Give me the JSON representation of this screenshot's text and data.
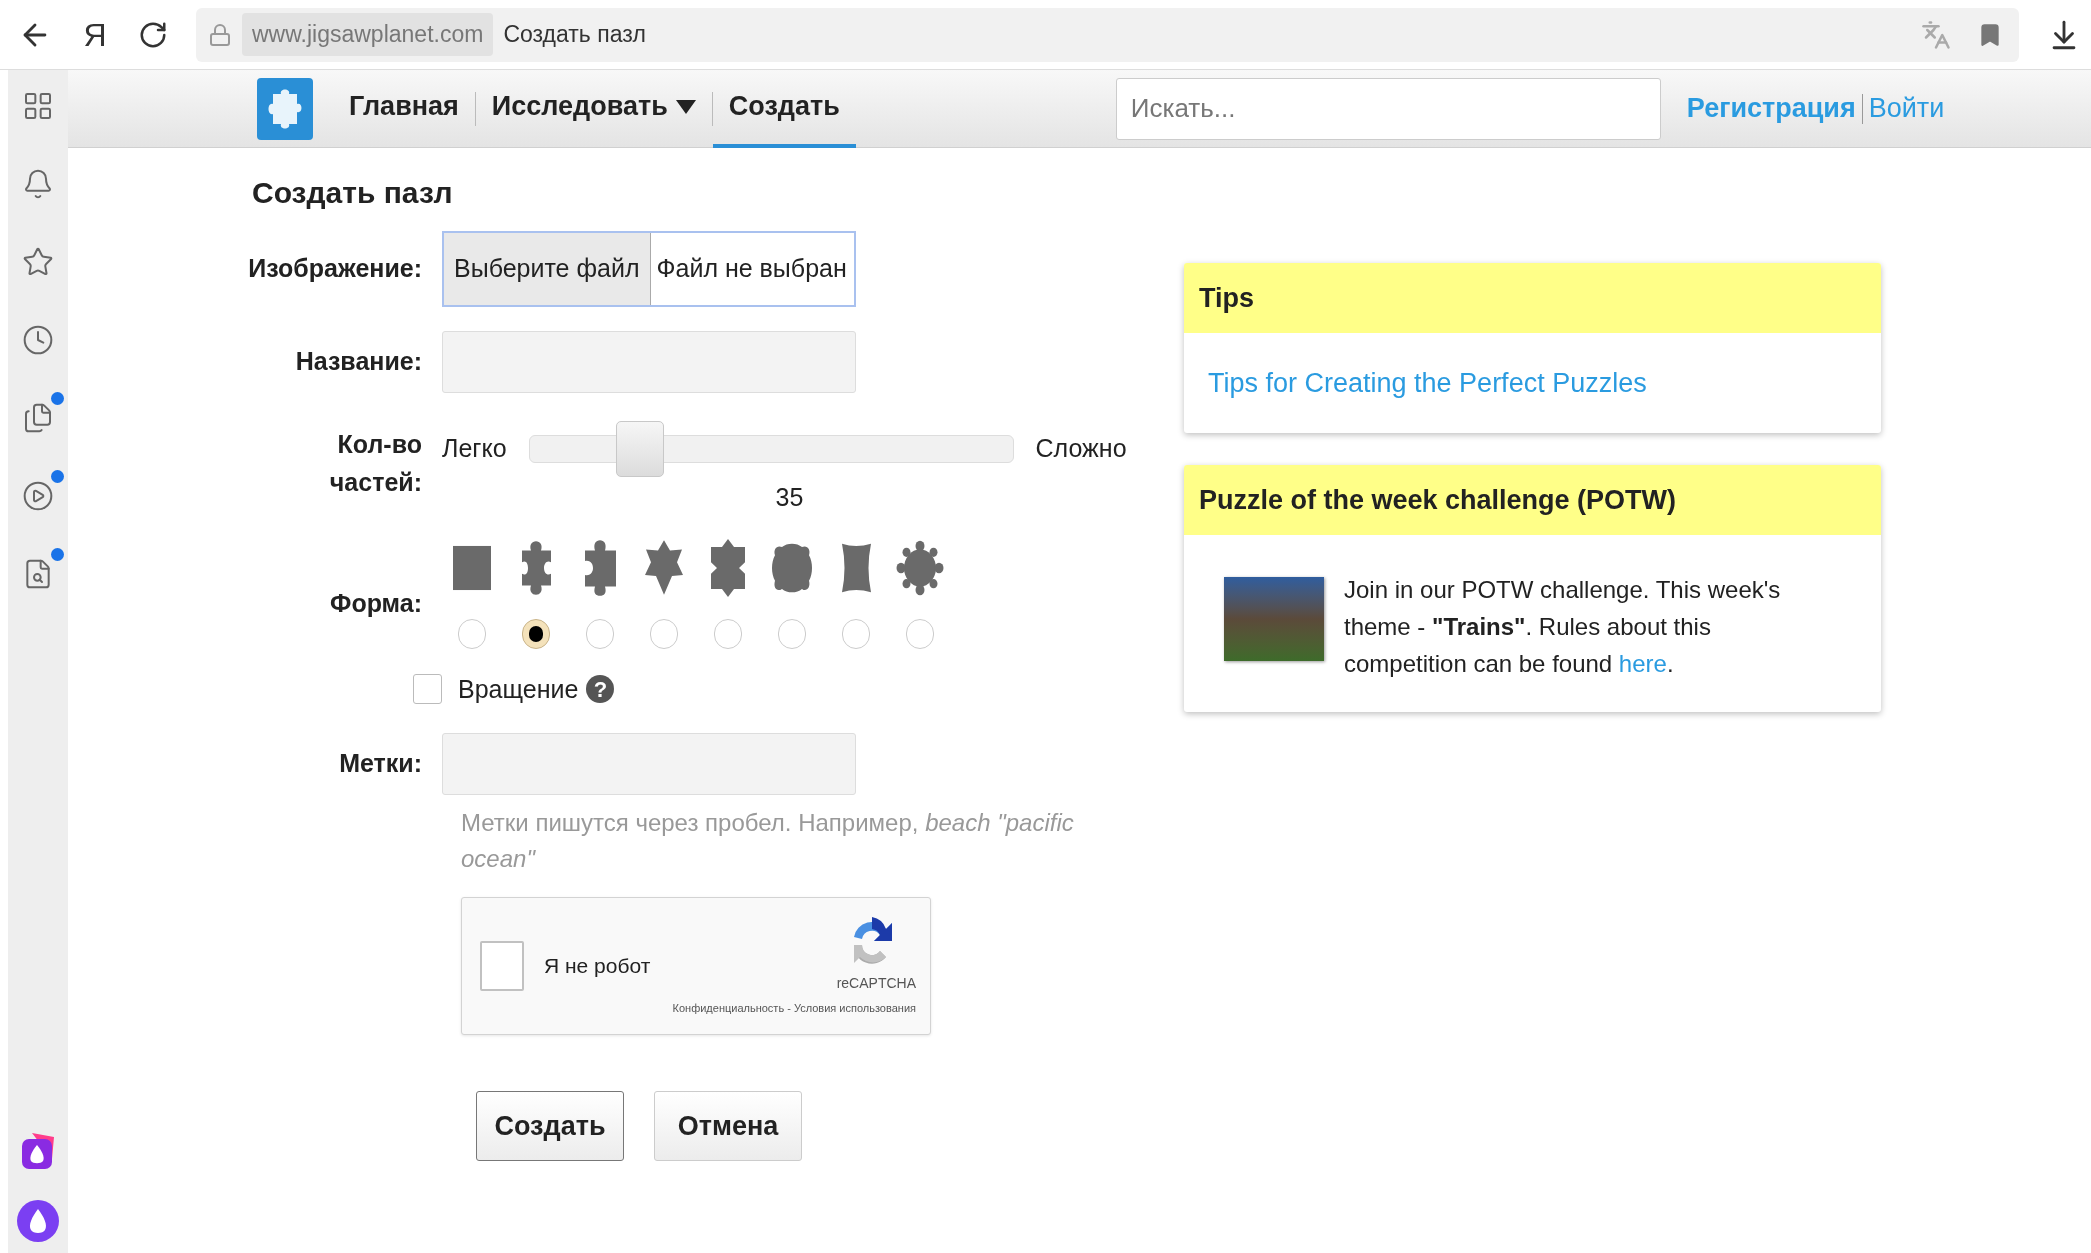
{
  "browser": {
    "logo": "Я",
    "domain": "www.jigsawplanet.com",
    "page_title": "Создать пазл"
  },
  "sidebar": {
    "items": [
      {
        "notification": false
      },
      {
        "notification": false
      },
      {
        "notification": false
      },
      {
        "notification": false
      },
      {
        "notification": true
      },
      {
        "notification": true
      },
      {
        "notification": true
      }
    ]
  },
  "nav": {
    "links": [
      {
        "label": "Главная",
        "selected": false,
        "dropdown": false
      },
      {
        "label": "Исследовать",
        "selected": false,
        "dropdown": true
      },
      {
        "label": "Создать",
        "selected": true,
        "dropdown": false
      }
    ],
    "search": {
      "placeholder": "Искать..."
    },
    "account": [
      "Регистрация",
      "Войти"
    ]
  },
  "form": {
    "title": "Создать пазл",
    "image": {
      "label": "Изображение:",
      "button": "Выберите файл",
      "status": "Файл не выбран"
    },
    "name": {
      "label": "Название:"
    },
    "pieces": {
      "label": "Кол-во частей:",
      "min_label": "Легко",
      "max_label": "Сложно",
      "level": 0.2,
      "value": "35"
    },
    "shape": {
      "label": "Форма:",
      "options": [
        {
          "selected": false
        },
        {
          "selected": true
        },
        {
          "selected": false
        },
        {
          "selected": false
        },
        {
          "selected": false
        },
        {
          "selected": false
        },
        {
          "selected": false
        },
        {
          "selected": false
        }
      ]
    },
    "rotation": {
      "label": "Вращение",
      "checked": false,
      "help": "?"
    },
    "tags": {
      "label": "Метки:",
      "hint": "Метки пишутся через пробел. Например, *beach \"pacific ocean\"*"
    },
    "captcha": {
      "label": "Я не робот",
      "checked": false,
      "brand": "reCAPTCHA",
      "links": "Конфиденциальность - Условия использования"
    },
    "buttons": [
      "Создать",
      "Отмена"
    ]
  },
  "tips": {
    "title": "Tips",
    "link": "Tips for Creating the Perfect Puzzles"
  },
  "potw": {
    "title": "Puzzle of the week challenge (POTW)",
    "text": "Join in our POTW challenge. This week's theme - **\"Trains\"**. Rules about this competition can be found",
    "link": "here",
    "end": "."
  }
}
